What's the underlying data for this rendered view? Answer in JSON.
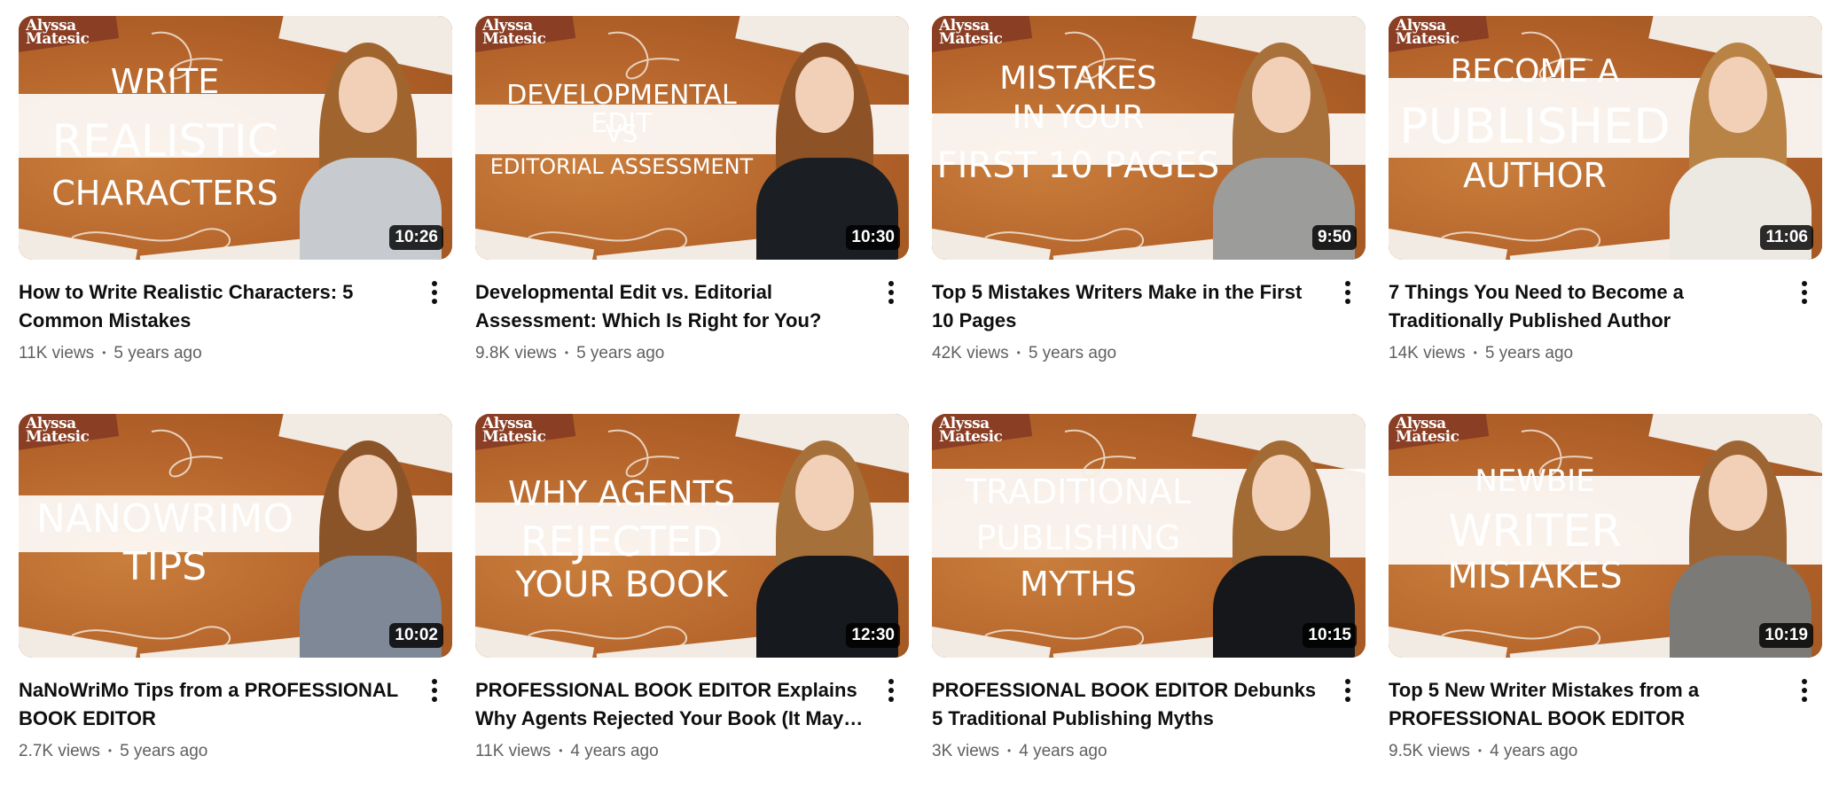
{
  "videos": [
    {
      "title": "How to Write Realistic Characters: 5 Common Mistakes",
      "views": "11K views",
      "age": "5 years ago",
      "duration": "10:26",
      "brand": [
        "Alyssa",
        "Matesic"
      ],
      "headline": [
        "WRITE",
        "REALISTIC",
        "CHARACTERS"
      ],
      "shirt": "#c7cbd0",
      "menu_icon": "more-vert-icon"
    },
    {
      "title": "Developmental Edit vs. Editorial Assessment: Which Is Right for You?",
      "views": "9.8K views",
      "age": "5 years ago",
      "duration": "10:30",
      "brand": [
        "Alyssa",
        "Matesic"
      ],
      "headline": [
        "DEVELOPMENTAL EDIT",
        "VS",
        "EDITORIAL ASSESSMENT"
      ],
      "shirt": "#1b1f24",
      "menu_icon": "more-vert-icon"
    },
    {
      "title": "Top 5 Mistakes Writers Make in the First 10 Pages",
      "views": "42K views",
      "age": "5 years ago",
      "duration": "9:50",
      "brand": [
        "Alyssa",
        "Matesic"
      ],
      "headline": [
        "MISTAKES",
        "IN YOUR",
        "FIRST 10 PAGES"
      ],
      "shirt": "#9c9c9a",
      "menu_icon": "more-vert-icon"
    },
    {
      "title": "7 Things You Need to Become a Traditionally Published Author",
      "views": "14K views",
      "age": "5 years ago",
      "duration": "11:06",
      "brand": [
        "Alyssa",
        "Matesic"
      ],
      "headline": [
        "BECOME A",
        "PUBLISHED",
        "AUTHOR"
      ],
      "shirt": "#ece8e2",
      "menu_icon": "more-vert-icon"
    },
    {
      "title": "NaNoWriMo Tips from a PROFESSIONAL BOOK EDITOR",
      "views": "2.7K views",
      "age": "5 years ago",
      "duration": "10:02",
      "brand": [
        "Alyssa",
        "Matesic"
      ],
      "headline": [
        "NANOWRIMO",
        "TIPS"
      ],
      "shirt": "#7e8896",
      "menu_icon": "more-vert-icon"
    },
    {
      "title": "PROFESSIONAL BOOK EDITOR Explains Why Agents Rejected Your Book (It May Not Be…",
      "views": "11K views",
      "age": "4 years ago",
      "duration": "12:30",
      "brand": [
        "Alyssa",
        "Matesic"
      ],
      "headline": [
        "WHY AGENTS",
        "REJECTED",
        "YOUR BOOK"
      ],
      "shirt": "#16191d",
      "menu_icon": "more-vert-icon"
    },
    {
      "title": "PROFESSIONAL BOOK EDITOR Debunks 5 Traditional Publishing Myths",
      "views": "3K views",
      "age": "4 years ago",
      "duration": "10:15",
      "brand": [
        "Alyssa",
        "Matesic"
      ],
      "headline": [
        "TRADITIONAL",
        "PUBLISHING",
        "MYTHS"
      ],
      "shirt": "#15171a",
      "menu_icon": "more-vert-icon"
    },
    {
      "title": "Top 5 New Writer Mistakes from a PROFESSIONAL BOOK EDITOR",
      "views": "9.5K views",
      "age": "4 years ago",
      "duration": "10:19",
      "brand": [
        "Alyssa",
        "Matesic"
      ],
      "headline": [
        "NEWBIE",
        "WRITER",
        "MISTAKES"
      ],
      "shirt": "#7b7a76",
      "menu_icon": "more-vert-icon"
    }
  ]
}
